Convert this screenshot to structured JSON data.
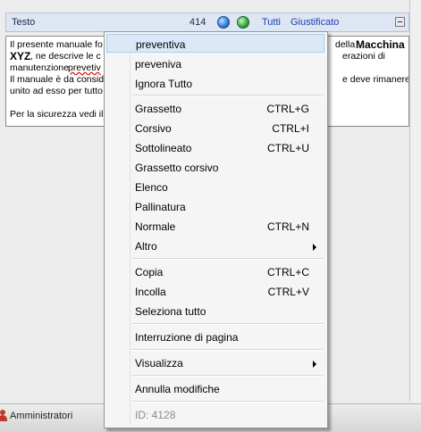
{
  "section": {
    "label": "Testo",
    "count": "414",
    "link_all": "Tutti",
    "link_align": "Giustificato"
  },
  "editor": {
    "l1a": "Il presente manuale fo",
    "l1b": "della",
    "l1c": "Macchina",
    "l2a": "XYZ",
    "l2b": ", ne descrive le c",
    "l2c": "erazioni di",
    "l3a": "manutenzione",
    "l3b": "prevetiv",
    "l4a": "Il manuale è da consid",
    "l4b": "e deve rimanere",
    "l5a": "unito ad esso per tutto",
    "l7a": "Per la sicurezza vedi il"
  },
  "status": {
    "user_label": "Amministratori"
  },
  "menu": {
    "items": [
      {
        "label": "preventiva",
        "shortcut": ""
      },
      {
        "label": "preveniva",
        "shortcut": ""
      },
      {
        "label": "Ignora Tutto",
        "shortcut": ""
      },
      {
        "label": "Grassetto",
        "shortcut": "CTRL+G"
      },
      {
        "label": "Corsivo",
        "shortcut": "CTRL+I"
      },
      {
        "label": "Sottolineato",
        "shortcut": "CTRL+U"
      },
      {
        "label": "Grassetto corsivo",
        "shortcut": ""
      },
      {
        "label": "Elenco",
        "shortcut": ""
      },
      {
        "label": "Pallinatura",
        "shortcut": ""
      },
      {
        "label": "Normale",
        "shortcut": "CTRL+N"
      },
      {
        "label": "Altro",
        "shortcut": ""
      },
      {
        "label": "Copia",
        "shortcut": "CTRL+C"
      },
      {
        "label": "Incolla",
        "shortcut": "CTRL+V"
      },
      {
        "label": "Seleziona tutto",
        "shortcut": ""
      },
      {
        "label": "Interruzione di pagina",
        "shortcut": ""
      },
      {
        "label": "Visualizza",
        "shortcut": ""
      },
      {
        "label": "Annulla modifiche",
        "shortcut": ""
      },
      {
        "label": "ID: 4128",
        "shortcut": ""
      }
    ]
  },
  "colors": {
    "header_bg": "#dde6f2",
    "link": "#1f3fb0",
    "menu_highlight": "#dbe8f7",
    "status_icon": "#c0392b"
  }
}
